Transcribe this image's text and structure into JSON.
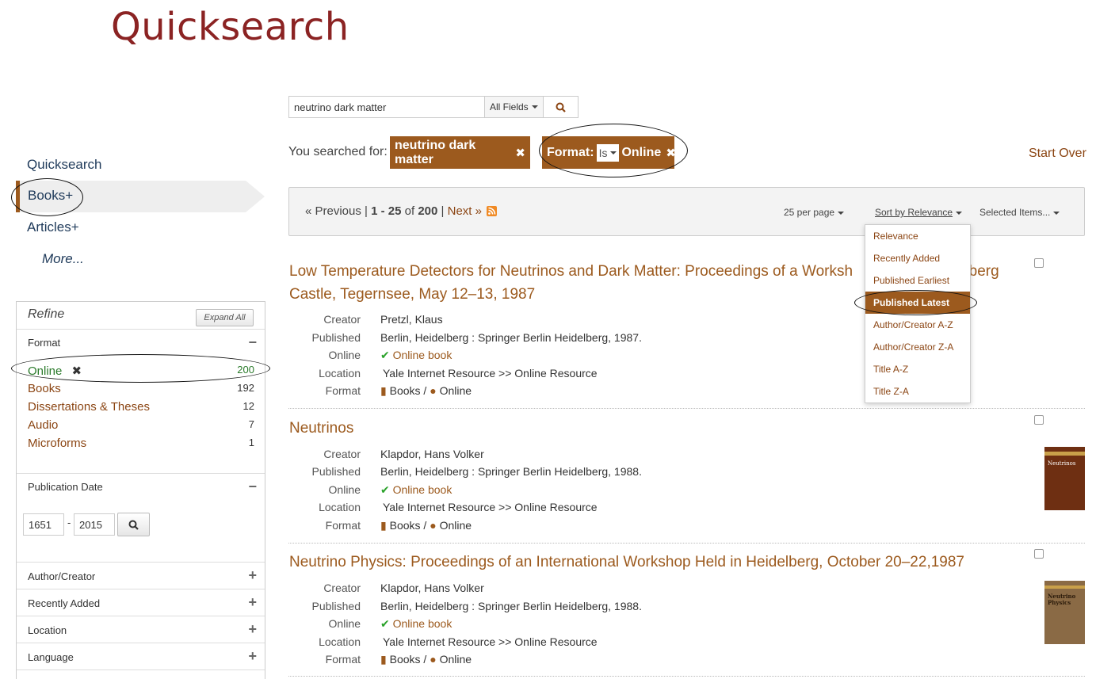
{
  "app": {
    "title": "Quicksearch"
  },
  "search": {
    "value": "neutrino dark matter",
    "field": "All Fields"
  },
  "searched": {
    "label": "You searched for:",
    "query_chip": "neutrino dark matter",
    "format_label": "Format:",
    "format_op": "Is",
    "format_value": "Online",
    "start_over": "Start Over"
  },
  "nav": {
    "quicksearch": "Quicksearch",
    "books": "Books+",
    "articles": "Articles+",
    "more": "More..."
  },
  "refine": {
    "title": "Refine",
    "expand_all": "Expand All",
    "format_head": "Format",
    "facets": [
      {
        "label": "Online",
        "count": "200"
      },
      {
        "label": "Books",
        "count": "192"
      },
      {
        "label": "Dissertations & Theses",
        "count": "12"
      },
      {
        "label": "Audio",
        "count": "7"
      },
      {
        "label": "Microforms",
        "count": "1"
      }
    ],
    "pubdate_head": "Publication Date",
    "year_from": "1651",
    "year_to": "2015",
    "sections": [
      "Author/Creator",
      "Recently Added",
      "Location",
      "Language"
    ]
  },
  "toolbar": {
    "previous": "« Previous",
    "range": "1 - 25",
    "of": "of",
    "total": "200",
    "next": "Next »",
    "per_page": "25 per page",
    "sort": "Sort by Relevance",
    "selected": "Selected Items..."
  },
  "sort_options": [
    "Relevance",
    "Recently Added",
    "Published Earliest",
    "Published Latest",
    "Author/Creator A-Z",
    "Author/Creator Z-A",
    "Title A-Z",
    "Title Z-A"
  ],
  "field_labels": {
    "creator": "Creator",
    "published": "Published",
    "online": "Online",
    "location": "Location",
    "format": "Format"
  },
  "results": [
    {
      "title_line1": "Low Temperature Detectors for Neutrinos and Dark Matter: Proceedings of a Worksh",
      "title_line1_tail": "gberg",
      "title_line2": "Castle, Tegernsee, May 12–13, 1987",
      "creator": "Pretzl, Klaus",
      "published": "Berlin, Heidelberg : Springer Berlin Heidelberg, 1987.",
      "online": "Online book",
      "location": "Yale Internet Resource >> Online Resource",
      "format_books": "Books",
      "format_online": "Online"
    },
    {
      "title_line1": "Neutrinos",
      "creator": "Klapdor, Hans Volker",
      "published": "Berlin, Heidelberg : Springer Berlin Heidelberg, 1988.",
      "online": "Online book",
      "location": "Yale Internet Resource >> Online Resource",
      "format_books": "Books",
      "format_online": "Online",
      "cover_text": "Neutrinos"
    },
    {
      "title_line1": "Neutrino Physics: Proceedings of an International Workshop Held in Heidelberg, October 20–22,1987",
      "creator": "Klapdor, Hans Volker",
      "published": "Berlin, Heidelberg : Springer Berlin Heidelberg, 1988.",
      "online": "Online book",
      "location": "Yale Internet Resource >> Online Resource",
      "format_books": "Books",
      "format_online": "Online",
      "cover_text": "Neutrino Physics"
    }
  ],
  "colors": {
    "brand": "#8b2323",
    "accent": "#9c5a1e",
    "nav": "#1f3a5a",
    "online_check": "#2aa22a"
  }
}
